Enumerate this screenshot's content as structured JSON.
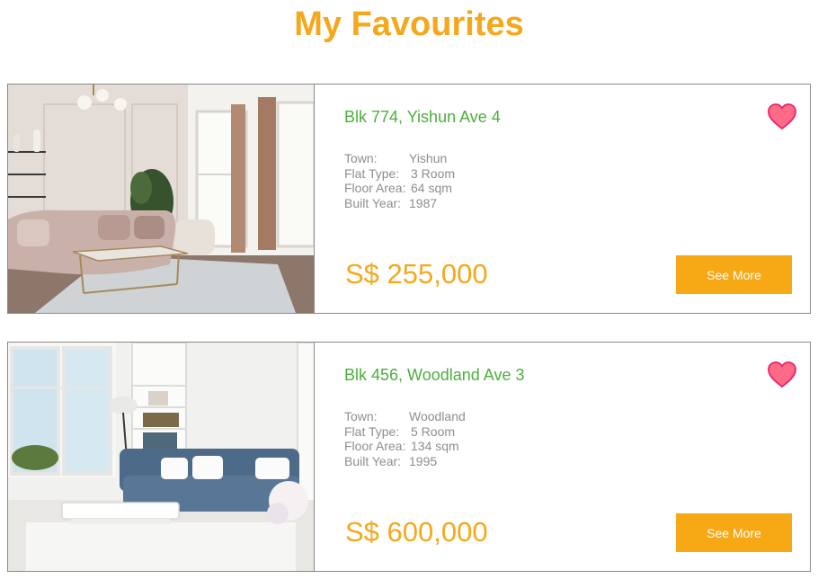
{
  "page": {
    "title": "My Favourites"
  },
  "colors": {
    "accent": "#f5a81c",
    "address": "#4caf3c",
    "heart": "#ff6a86",
    "heart_stroke": "#e8246a"
  },
  "listings": [
    {
      "address": "Blk 774, Yishun Ave 4",
      "details": {
        "town_label": "Town:",
        "town": "Yishun",
        "flat_type_label": "Flat Type:",
        "flat_type": "3 Room",
        "floor_area_label": "Floor Area:",
        "floor_area": "64 sqm",
        "built_year_label": "Built Year:",
        "built_year": "1987"
      },
      "price": "S$ 255,000",
      "button_label": "See More",
      "favourite_icon": "heart-icon"
    },
    {
      "address": "Blk 456, Woodland Ave 3",
      "details": {
        "town_label": "Town:",
        "town": "Woodland",
        "flat_type_label": "Flat Type:",
        "flat_type": "5 Room",
        "floor_area_label": "Floor Area:",
        "floor_area": "134 sqm",
        "built_year_label": "Built Year:",
        "built_year": "1995"
      },
      "price": "S$ 600,000",
      "button_label": "See More",
      "favourite_icon": "heart-icon"
    }
  ]
}
